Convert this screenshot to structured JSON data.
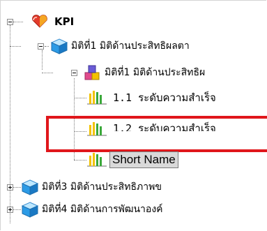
{
  "tree": {
    "root": {
      "label": "KPI",
      "icon": "heart-icon",
      "expander": "minus"
    },
    "dimension1": {
      "label": "มิติที่1 มิติด้านประสิทธิผลตา",
      "icon": "cube-icon",
      "expander": "minus"
    },
    "subdimension1": {
      "label": "มิติที่1 มิติด้านประสิทธิผ",
      "icon": "blocks-icon",
      "expander": "minus"
    },
    "kpi_1_1": {
      "label": "1.1 ระดับความสำเร็จ",
      "icon": "bar-chart-icon"
    },
    "kpi_1_2": {
      "label": "1.2 ระดับความสำเร็จ",
      "icon": "bar-chart-icon"
    },
    "editing": {
      "label": "Short Name",
      "icon": "bar-chart-icon"
    },
    "dimension3": {
      "label": "มิติที่3 มิติด้านประสิทธิภาพข",
      "icon": "cube-icon",
      "expander": "plus"
    },
    "dimension4": {
      "label": "มิติที่4 มิติด้านการพัฒนาองค์",
      "icon": "cube-icon",
      "expander": "plus"
    }
  },
  "colors": {
    "highlight": "#e0161b",
    "selected_bg": "#d9d9d9",
    "bar_yellow": "#f2c200",
    "bar_green": "#3aa83a"
  }
}
